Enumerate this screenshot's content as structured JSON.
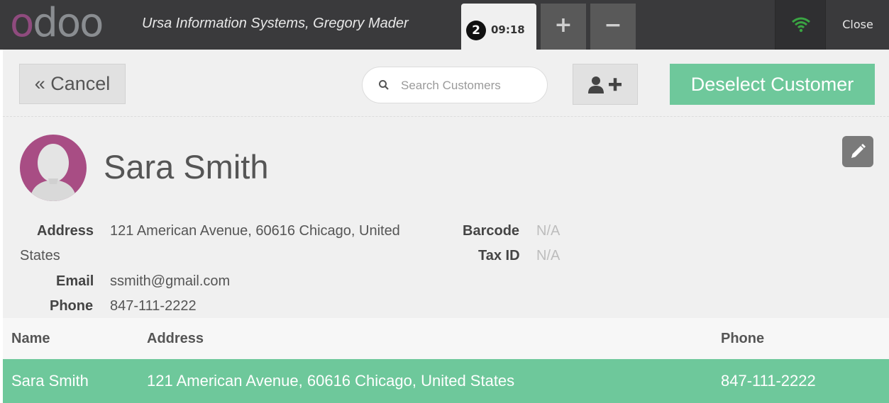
{
  "topbar": {
    "logo_text": "odoo",
    "shop_name": "Ursa Information Systems, Gregory Mader",
    "order": {
      "number": "2",
      "time": "09:18"
    },
    "add_order_symbol": "+",
    "remove_order_symbol": "−",
    "wifi_icon": "wifi-icon",
    "wifi_color": "#3aa543",
    "close_label": "Close"
  },
  "toolbar": {
    "cancel_label": "« Cancel",
    "search_placeholder": "Search Customers",
    "search_value": "",
    "add_customer_icon": "add-user-icon",
    "deselect_label": "Deselect Customer"
  },
  "customer": {
    "name": "Sara Smith",
    "address_label": "Address",
    "address_line1": "121 American Avenue, 60616 Chicago, United",
    "address_line2": "States",
    "email_label": "Email",
    "email": "ssmith@gmail.com",
    "phone_label": "Phone",
    "phone": "847-111-2222",
    "barcode_label": "Barcode",
    "barcode": "N/A",
    "taxid_label": "Tax ID",
    "taxid": "N/A"
  },
  "table": {
    "headers": {
      "name": "Name",
      "address": "Address",
      "phone": "Phone"
    },
    "rows": [
      {
        "name": "Sara Smith",
        "address": "121 American Avenue, 60616 Chicago, United States",
        "phone": "847-111-2222"
      }
    ]
  },
  "colors": {
    "accent": "#6ec89b",
    "topbar": "#3a3a3c",
    "avatar": "#a84d84",
    "logo_first_o": "#8f4b7e"
  }
}
